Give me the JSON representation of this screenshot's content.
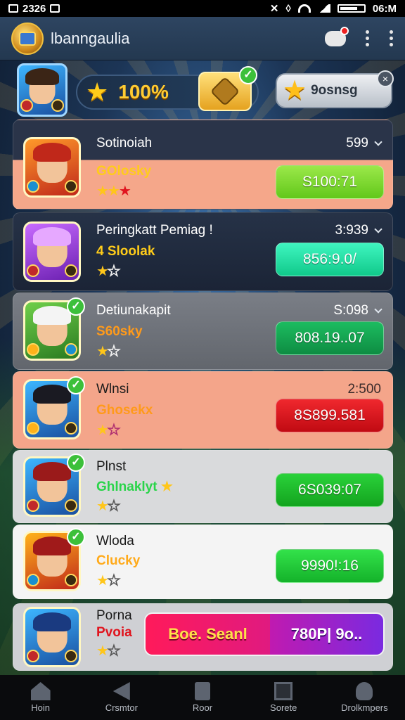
{
  "status_bar": {
    "time_left": "2326",
    "time_right": "06:M"
  },
  "app_bar": {
    "title": "lbanngaulia"
  },
  "top_strip": {
    "percent": "100%",
    "chip_label": "9osnsg"
  },
  "players": [
    {
      "name": "Sotinoiah",
      "subtitle": "GOlosky",
      "rank": "599",
      "value": "S100:71",
      "card_bg": "#f5a78a",
      "btn_color": "#7fd62a",
      "sub_color": "#ffcc1a",
      "has_chevron": true,
      "verified": false
    },
    {
      "name": "Peringkatt Pemiag !",
      "subtitle": "4 Sloolak",
      "rank": "3:939",
      "value": "856:9.0/",
      "card_bg": "#1f2a3d",
      "btn_color": "#19e0a0",
      "sub_color": "#ffcc1a",
      "has_chevron": true,
      "verified": false
    },
    {
      "name": "Detiunakapit",
      "subtitle": "S60sky",
      "rank": "S:098",
      "value": "808.19..07",
      "card_bg": "#6f737a",
      "btn_color": "#13a552",
      "sub_color": "#ff9a1a",
      "has_chevron": true,
      "verified": true
    },
    {
      "name": "Wlnsi",
      "subtitle": "Ghosekx",
      "rank": "2:500",
      "value": "8S899.581",
      "card_bg": "#f4a58a",
      "btn_color": "#e0141e",
      "sub_color": "#ff9a1a",
      "has_chevron": false,
      "verified": true
    },
    {
      "name": "Plnst",
      "subtitle": "Ghlnaklyt",
      "rank": "",
      "value": "6S039:07",
      "card_bg": "#d9dadc",
      "btn_color": "#19c02a",
      "sub_color": "#2ad44a",
      "has_chevron": false,
      "verified": true
    },
    {
      "name": "Wloda",
      "subtitle": "Clucky",
      "rank": "",
      "value": "9990!:16",
      "card_bg": "#f4f4f4",
      "btn_color": "#1fd43a",
      "sub_color": "#ffaa1a",
      "has_chevron": false,
      "verified": true
    },
    {
      "name": "Porna",
      "subtitle": "Pvoia",
      "rank": "",
      "value": "",
      "card_bg": "#cfd0d4",
      "btn_color": "",
      "sub_color": "#e0141e",
      "has_chevron": false,
      "verified": false
    }
  ],
  "promo_button": {
    "left_label": "Boe. Seanl",
    "right_label": "780P| 9o.."
  },
  "bottom_nav": [
    {
      "label": "Hoin",
      "icon": "home-icon"
    },
    {
      "label": "Crsmtor",
      "icon": "back-arrow-icon"
    },
    {
      "label": "Roor",
      "icon": "clipboard-icon"
    },
    {
      "label": "Sorete",
      "icon": "square-icon"
    },
    {
      "label": "Drolkmpers",
      "icon": "user-icon"
    }
  ]
}
